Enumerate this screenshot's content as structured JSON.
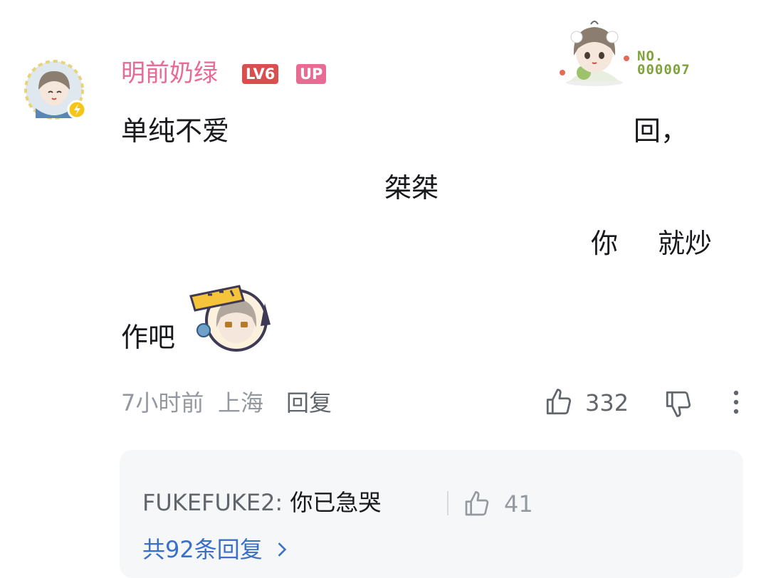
{
  "comment": {
    "username": "明前奶绿",
    "level_badge": "LV6",
    "up_badge": "UP",
    "fan_no": "NO.\n000007",
    "lines": [
      "单纯不爱",
      "回，",
      "桀桀",
      "你",
      "就炒",
      "作吧"
    ],
    "time": "7小时前",
    "location": "上海",
    "reply_label": "回复",
    "like_count": "332"
  },
  "reply_preview": {
    "name": "FUKEFUKE2:",
    "text": "你已急哭",
    "likes": "41",
    "more_label": "共92条回复"
  },
  "colors": {
    "username": "#e86b94",
    "level_badge": "#d94f4f",
    "up_badge": "#e86b94",
    "link": "#3a70c7",
    "meta": "#9499a0"
  }
}
